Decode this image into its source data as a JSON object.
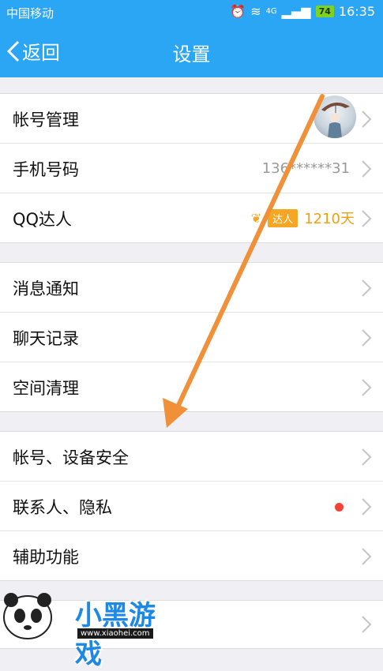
{
  "status": {
    "carrier": "中国移动",
    "signal_badge": "4G",
    "battery": "74",
    "time": "16:35"
  },
  "nav": {
    "back_label": "返回",
    "title": "设置"
  },
  "groups": [
    {
      "items": [
        {
          "label": "帐号管理"
        },
        {
          "label": "手机号码",
          "value": "136******31"
        },
        {
          "label": "QQ达人",
          "badge": "达人",
          "days": "1210天"
        }
      ]
    },
    {
      "items": [
        {
          "label": "消息通知"
        },
        {
          "label": "聊天记录"
        },
        {
          "label": "空间清理"
        }
      ]
    },
    {
      "items": [
        {
          "label": "帐号、设备安全"
        },
        {
          "label": "联系人、隐私"
        },
        {
          "label": "辅助功能"
        }
      ]
    }
  ],
  "watermark": {
    "brand": "小黑游戏",
    "url": "www.xiaohei.com"
  },
  "colors": {
    "accent": "#2aa6f4",
    "arrow": "#f0913a",
    "badge": "#f5a623",
    "dot": "#f44336"
  }
}
